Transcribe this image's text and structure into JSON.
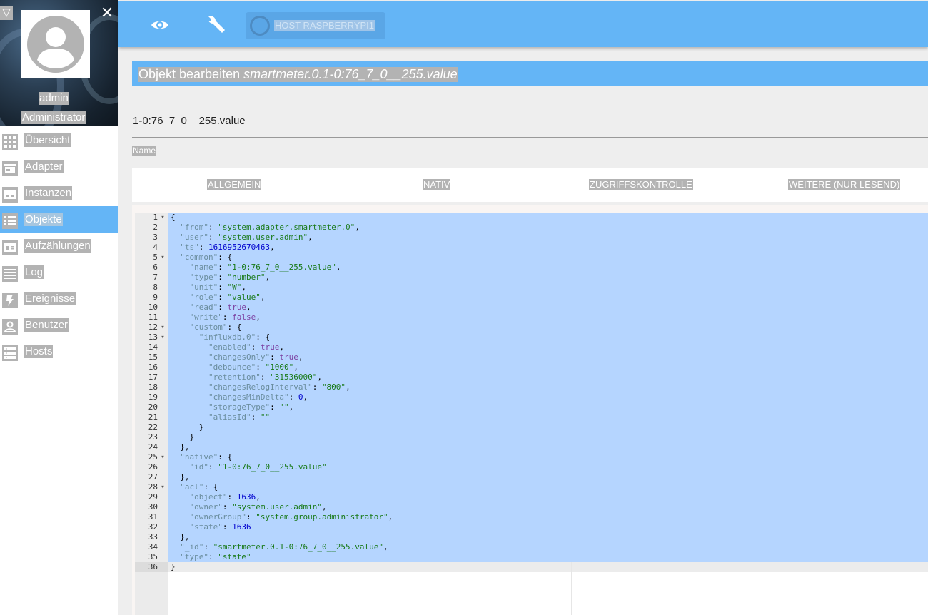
{
  "sidebar": {
    "username": "admin",
    "role": "Administrator",
    "items": [
      {
        "label": "Übersicht",
        "icon": "grid-icon"
      },
      {
        "label": "Adapter",
        "icon": "store-icon"
      },
      {
        "label": "Instanzen",
        "icon": "subtitles-icon"
      },
      {
        "label": "Objekte",
        "icon": "list-icon",
        "active": true
      },
      {
        "label": "Aufzählungen",
        "icon": "card-icon"
      },
      {
        "label": "Log",
        "icon": "lines-icon"
      },
      {
        "label": "Ereignisse",
        "icon": "flash-icon"
      },
      {
        "label": "Benutzer",
        "icon": "user-icon"
      },
      {
        "label": "Hosts",
        "icon": "servers-icon"
      }
    ]
  },
  "topbar": {
    "host_label": "HOST RASPBERRYPI1"
  },
  "dialog": {
    "title_prefix": "Objekt bearbeiten ",
    "title_object": "smartmeter.0.1-0:76_7_0__255.value",
    "name_value": "1-0:76_7_0__255.value",
    "name_label": "Name",
    "tabs": [
      "ALLGEMEIN",
      "NATIV",
      "ZUGRIFFSKONTROLLE",
      "WEITERE (NUR LESEND)"
    ]
  },
  "editor": {
    "lines": [
      {
        "n": "1",
        "fold": true,
        "code": [
          [
            "p",
            "{"
          ]
        ]
      },
      {
        "n": "2",
        "code": [
          [
            "p",
            "  "
          ],
          [
            "k",
            "\"from\""
          ],
          [
            "p",
            ": "
          ],
          [
            "s",
            "\"system.adapter.smartmeter.0\""
          ],
          [
            "p",
            ","
          ]
        ]
      },
      {
        "n": "3",
        "code": [
          [
            "p",
            "  "
          ],
          [
            "k",
            "\"user\""
          ],
          [
            "p",
            ": "
          ],
          [
            "s",
            "\"system.user.admin\""
          ],
          [
            "p",
            ","
          ]
        ]
      },
      {
        "n": "4",
        "code": [
          [
            "p",
            "  "
          ],
          [
            "k",
            "\"ts\""
          ],
          [
            "p",
            ": "
          ],
          [
            "n",
            "1616952670463"
          ],
          [
            "p",
            ","
          ]
        ]
      },
      {
        "n": "5",
        "fold": true,
        "code": [
          [
            "p",
            "  "
          ],
          [
            "k",
            "\"common\""
          ],
          [
            "p",
            ": {"
          ]
        ]
      },
      {
        "n": "6",
        "code": [
          [
            "p",
            "    "
          ],
          [
            "k",
            "\"name\""
          ],
          [
            "p",
            ": "
          ],
          [
            "s",
            "\"1-0:76_7_0__255.value\""
          ],
          [
            "p",
            ","
          ]
        ]
      },
      {
        "n": "7",
        "code": [
          [
            "p",
            "    "
          ],
          [
            "k",
            "\"type\""
          ],
          [
            "p",
            ": "
          ],
          [
            "s",
            "\"number\""
          ],
          [
            "p",
            ","
          ]
        ]
      },
      {
        "n": "8",
        "code": [
          [
            "p",
            "    "
          ],
          [
            "k",
            "\"unit\""
          ],
          [
            "p",
            ": "
          ],
          [
            "s",
            "\"W\""
          ],
          [
            "p",
            ","
          ]
        ]
      },
      {
        "n": "9",
        "code": [
          [
            "p",
            "    "
          ],
          [
            "k",
            "\"role\""
          ],
          [
            "p",
            ": "
          ],
          [
            "s",
            "\"value\""
          ],
          [
            "p",
            ","
          ]
        ]
      },
      {
        "n": "10",
        "code": [
          [
            "p",
            "    "
          ],
          [
            "k",
            "\"read\""
          ],
          [
            "p",
            ": "
          ],
          [
            "b",
            "true"
          ],
          [
            "p",
            ","
          ]
        ]
      },
      {
        "n": "11",
        "code": [
          [
            "p",
            "    "
          ],
          [
            "k",
            "\"write\""
          ],
          [
            "p",
            ": "
          ],
          [
            "b",
            "false"
          ],
          [
            "p",
            ","
          ]
        ]
      },
      {
        "n": "12",
        "fold": true,
        "code": [
          [
            "p",
            "    "
          ],
          [
            "k",
            "\"custom\""
          ],
          [
            "p",
            ": {"
          ]
        ]
      },
      {
        "n": "13",
        "fold": true,
        "code": [
          [
            "p",
            "      "
          ],
          [
            "k",
            "\"influxdb.0\""
          ],
          [
            "p",
            ": {"
          ]
        ]
      },
      {
        "n": "14",
        "code": [
          [
            "p",
            "        "
          ],
          [
            "k",
            "\"enabled\""
          ],
          [
            "p",
            ": "
          ],
          [
            "b",
            "true"
          ],
          [
            "p",
            ","
          ]
        ]
      },
      {
        "n": "15",
        "code": [
          [
            "p",
            "        "
          ],
          [
            "k",
            "\"changesOnly\""
          ],
          [
            "p",
            ": "
          ],
          [
            "b",
            "true"
          ],
          [
            "p",
            ","
          ]
        ]
      },
      {
        "n": "16",
        "code": [
          [
            "p",
            "        "
          ],
          [
            "k",
            "\"debounce\""
          ],
          [
            "p",
            ": "
          ],
          [
            "s",
            "\"1000\""
          ],
          [
            "p",
            ","
          ]
        ]
      },
      {
        "n": "17",
        "code": [
          [
            "p",
            "        "
          ],
          [
            "k",
            "\"retention\""
          ],
          [
            "p",
            ": "
          ],
          [
            "s",
            "\"31536000\""
          ],
          [
            "p",
            ","
          ]
        ]
      },
      {
        "n": "18",
        "code": [
          [
            "p",
            "        "
          ],
          [
            "k",
            "\"changesRelogInterval\""
          ],
          [
            "p",
            ": "
          ],
          [
            "s",
            "\"800\""
          ],
          [
            "p",
            ","
          ]
        ]
      },
      {
        "n": "19",
        "code": [
          [
            "p",
            "        "
          ],
          [
            "k",
            "\"changesMinDelta\""
          ],
          [
            "p",
            ": "
          ],
          [
            "n",
            "0"
          ],
          [
            "p",
            ","
          ]
        ]
      },
      {
        "n": "20",
        "code": [
          [
            "p",
            "        "
          ],
          [
            "k",
            "\"storageType\""
          ],
          [
            "p",
            ": "
          ],
          [
            "s",
            "\"\""
          ],
          [
            "p",
            ","
          ]
        ]
      },
      {
        "n": "21",
        "code": [
          [
            "p",
            "        "
          ],
          [
            "k",
            "\"aliasId\""
          ],
          [
            "p",
            ": "
          ],
          [
            "s",
            "\"\""
          ]
        ]
      },
      {
        "n": "22",
        "code": [
          [
            "p",
            "      }"
          ]
        ]
      },
      {
        "n": "23",
        "code": [
          [
            "p",
            "    }"
          ]
        ]
      },
      {
        "n": "24",
        "code": [
          [
            "p",
            "  },"
          ]
        ]
      },
      {
        "n": "25",
        "fold": true,
        "code": [
          [
            "p",
            "  "
          ],
          [
            "k",
            "\"native\""
          ],
          [
            "p",
            ": {"
          ]
        ]
      },
      {
        "n": "26",
        "code": [
          [
            "p",
            "    "
          ],
          [
            "k",
            "\"id\""
          ],
          [
            "p",
            ": "
          ],
          [
            "s",
            "\"1-0:76_7_0__255.value\""
          ]
        ]
      },
      {
        "n": "27",
        "code": [
          [
            "p",
            "  },"
          ]
        ]
      },
      {
        "n": "28",
        "fold": true,
        "code": [
          [
            "p",
            "  "
          ],
          [
            "k",
            "\"acl\""
          ],
          [
            "p",
            ": {"
          ]
        ]
      },
      {
        "n": "29",
        "code": [
          [
            "p",
            "    "
          ],
          [
            "k",
            "\"object\""
          ],
          [
            "p",
            ": "
          ],
          [
            "n",
            "1636"
          ],
          [
            "p",
            ","
          ]
        ]
      },
      {
        "n": "30",
        "code": [
          [
            "p",
            "    "
          ],
          [
            "k",
            "\"owner\""
          ],
          [
            "p",
            ": "
          ],
          [
            "s",
            "\"system.user.admin\""
          ],
          [
            "p",
            ","
          ]
        ]
      },
      {
        "n": "31",
        "code": [
          [
            "p",
            "    "
          ],
          [
            "k",
            "\"ownerGroup\""
          ],
          [
            "p",
            ": "
          ],
          [
            "s",
            "\"system.group.administrator\""
          ],
          [
            "p",
            ","
          ]
        ]
      },
      {
        "n": "32",
        "code": [
          [
            "p",
            "    "
          ],
          [
            "k",
            "\"state\""
          ],
          [
            "p",
            ": "
          ],
          [
            "n",
            "1636"
          ]
        ]
      },
      {
        "n": "33",
        "code": [
          [
            "p",
            "  },"
          ]
        ]
      },
      {
        "n": "34",
        "code": [
          [
            "p",
            "  "
          ],
          [
            "k",
            "\"_id\""
          ],
          [
            "p",
            ": "
          ],
          [
            "s",
            "\"smartmeter.0.1-0:76_7_0__255.value\""
          ],
          [
            "p",
            ","
          ]
        ]
      },
      {
        "n": "35",
        "code": [
          [
            "p",
            "  "
          ],
          [
            "k",
            "\"type\""
          ],
          [
            "p",
            ": "
          ],
          [
            "s",
            "\"state\""
          ]
        ]
      },
      {
        "n": "36",
        "code": [
          [
            "p",
            "}"
          ]
        ]
      }
    ]
  }
}
